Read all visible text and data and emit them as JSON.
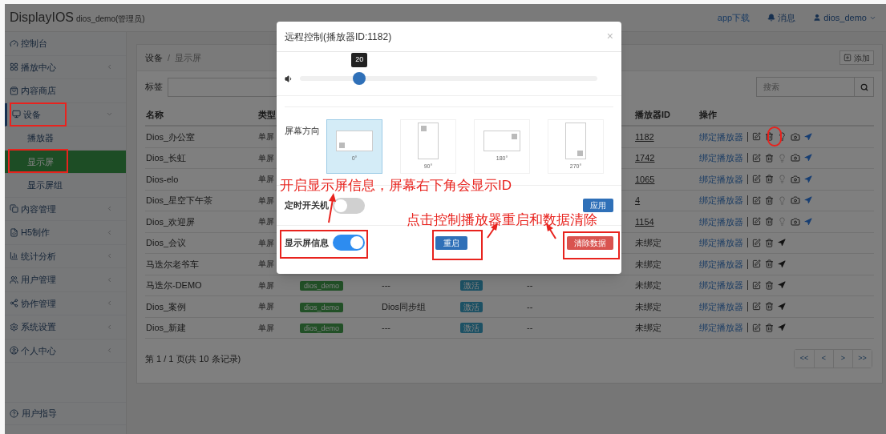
{
  "header": {
    "brand": "DisplayIOS",
    "account": "dios_demo(管理员)",
    "links": [
      {
        "kind": "download",
        "label": "app下载"
      },
      {
        "kind": "messages",
        "label": "消息"
      },
      {
        "kind": "user",
        "label": "dios_demo"
      }
    ]
  },
  "sidebar": {
    "items": [
      {
        "label": "控制台",
        "kind": "link"
      },
      {
        "label": "播放中心",
        "kind": "menu",
        "expanded": false
      },
      {
        "label": "内容商店",
        "kind": "link"
      },
      {
        "label": "设备",
        "kind": "menu",
        "expanded": true,
        "children": [
          {
            "label": "播放器",
            "selected": false
          },
          {
            "label": "显示屏",
            "selected": true
          },
          {
            "label": "显示屏组",
            "selected": false
          }
        ]
      },
      {
        "label": "内容管理",
        "kind": "menu",
        "expanded": false
      },
      {
        "label": "H5制作",
        "kind": "menu",
        "expanded": false
      },
      {
        "label": "统计分析",
        "kind": "menu",
        "expanded": false
      },
      {
        "label": "用户管理",
        "kind": "menu",
        "expanded": false
      },
      {
        "label": "协作管理",
        "kind": "menu",
        "expanded": false
      },
      {
        "label": "系统设置",
        "kind": "menu",
        "expanded": false
      },
      {
        "label": "个人中心",
        "kind": "menu",
        "expanded": false
      }
    ],
    "footer": "用户指导"
  },
  "breadcrumb": [
    "设备",
    "显示屏"
  ],
  "breadcrumb_separator": "/",
  "add_button": "添加",
  "filter": {
    "label": "标签",
    "search_placeholder": "搜索"
  },
  "table": {
    "columns": {
      "name": "名称",
      "type": "类型",
      "player_id": "播放器ID",
      "actions": "操作"
    },
    "rows": [
      {
        "name": "Dios_办公室",
        "type": "单屏",
        "player_id": "1182",
        "bound": true,
        "action_link": "绑定播放器"
      },
      {
        "name": "Dios_长虹",
        "type": "单屏",
        "player_id": "1742",
        "bound": true,
        "action_link": "绑定播放器"
      },
      {
        "name": "Dios-elo",
        "type": "单屏",
        "player_id": "1065",
        "bound": true,
        "action_link": "绑定播放器"
      },
      {
        "name": "Dios_星空下午茶",
        "type": "单屏",
        "player_id": "4",
        "bound": true,
        "action_link": "绑定播放器"
      },
      {
        "name": "Dios_欢迎屏",
        "type": "单屏",
        "player_id": "1154",
        "bound": true,
        "action_link": "绑定播放器"
      },
      {
        "name": "Dios_会议",
        "type": "单屏",
        "player_id": "未绑定",
        "bound": false,
        "action_link": "绑定播放器"
      },
      {
        "name": "马迭尔老爷车",
        "type": "单屏",
        "player_id": "未绑定",
        "bound": false,
        "action_link": "绑定播放器"
      },
      {
        "name": "马迭尔-DEMO",
        "type": "单屏",
        "tag": "dios_demo",
        "group": "---",
        "status": "激活",
        "column_6": "--",
        "player_id": "未绑定",
        "bound": false,
        "action_link": "绑定播放器"
      },
      {
        "name": "Dios_案例",
        "type": "单屏",
        "tag": "dios_demo",
        "group": "Dios同步组",
        "status": "激活",
        "column_6": "--",
        "player_id": "未绑定",
        "bound": false,
        "action_link": "绑定播放器"
      },
      {
        "name": "Dios_新建",
        "type": "单屏",
        "tag": "dios_demo",
        "group": "---",
        "status": "激活",
        "column_6": "--",
        "player_id": "未绑定",
        "bound": false,
        "action_link": "绑定播放器"
      }
    ]
  },
  "pagination": {
    "summary": "第 1 / 1 页(共 10 条记录)",
    "buttons": [
      "<<",
      "<",
      ">",
      ">>"
    ]
  },
  "modal": {
    "title": "远程控制(播放器ID:1182)",
    "close": "×",
    "volume": {
      "level": 0.2,
      "reading": "20"
    },
    "orientation": {
      "label": "屏幕方向",
      "options": [
        {
          "label": "0°",
          "selected": true
        },
        {
          "label": "90°",
          "selected": false
        },
        {
          "label": "180°",
          "selected": false
        },
        {
          "label": "270°",
          "selected": false
        }
      ]
    },
    "schedule": {
      "label": "定时开关机",
      "on": false
    },
    "apply_button": "应用",
    "display_info": {
      "label": "显示屏信息",
      "on": true
    },
    "restart_button": "重启",
    "clear_button": "清除数据"
  },
  "annotations": [
    "开启显示屏信息，屏幕右下角会显示ID",
    "点击控制播放器重启和数据清除"
  ]
}
